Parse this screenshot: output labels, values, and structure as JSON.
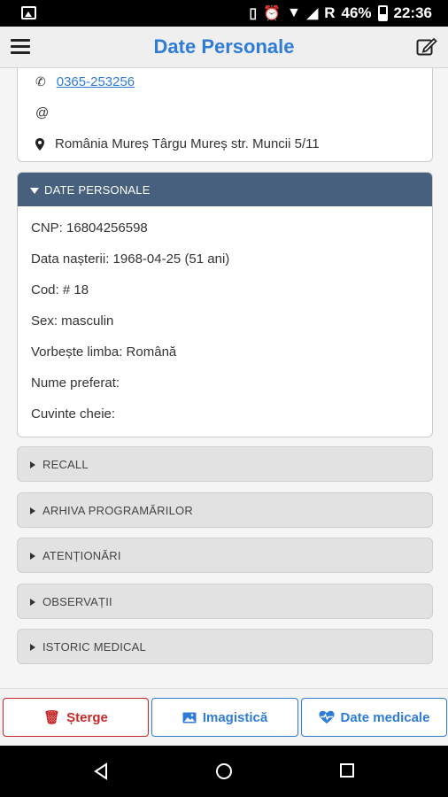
{
  "status_bar": {
    "network_label": "R",
    "battery": "46%",
    "time": "22:36"
  },
  "header": {
    "title": "Date Personale"
  },
  "contact": {
    "phone": "0365-253256",
    "email_symbol": "@",
    "address": "România Mureș Târgu Mureș str. Muncii 5/11"
  },
  "personal": {
    "heading": "DATE PERSONALE",
    "fields": [
      "CNP: 16804256598",
      "Data nașterii: 1968-04-25 (51 ani)",
      "Cod: # 18",
      "Sex: masculin",
      "Vorbește limba: Română",
      "Nume preferat:",
      "Cuvinte cheie:"
    ]
  },
  "sections": [
    "RECALL",
    "ARHIVA PROGRAMĂRILOR",
    "ATENȚIONĂRI",
    "OBSERVAȚII",
    "ISTORIC MEDICAL"
  ],
  "actions": {
    "delete": "Șterge",
    "imaging": "Imagistică",
    "medical": "Date medicale"
  },
  "colors": {
    "accent": "#2e7cd6",
    "panel_header": "#46607d",
    "danger": "#c62828"
  }
}
